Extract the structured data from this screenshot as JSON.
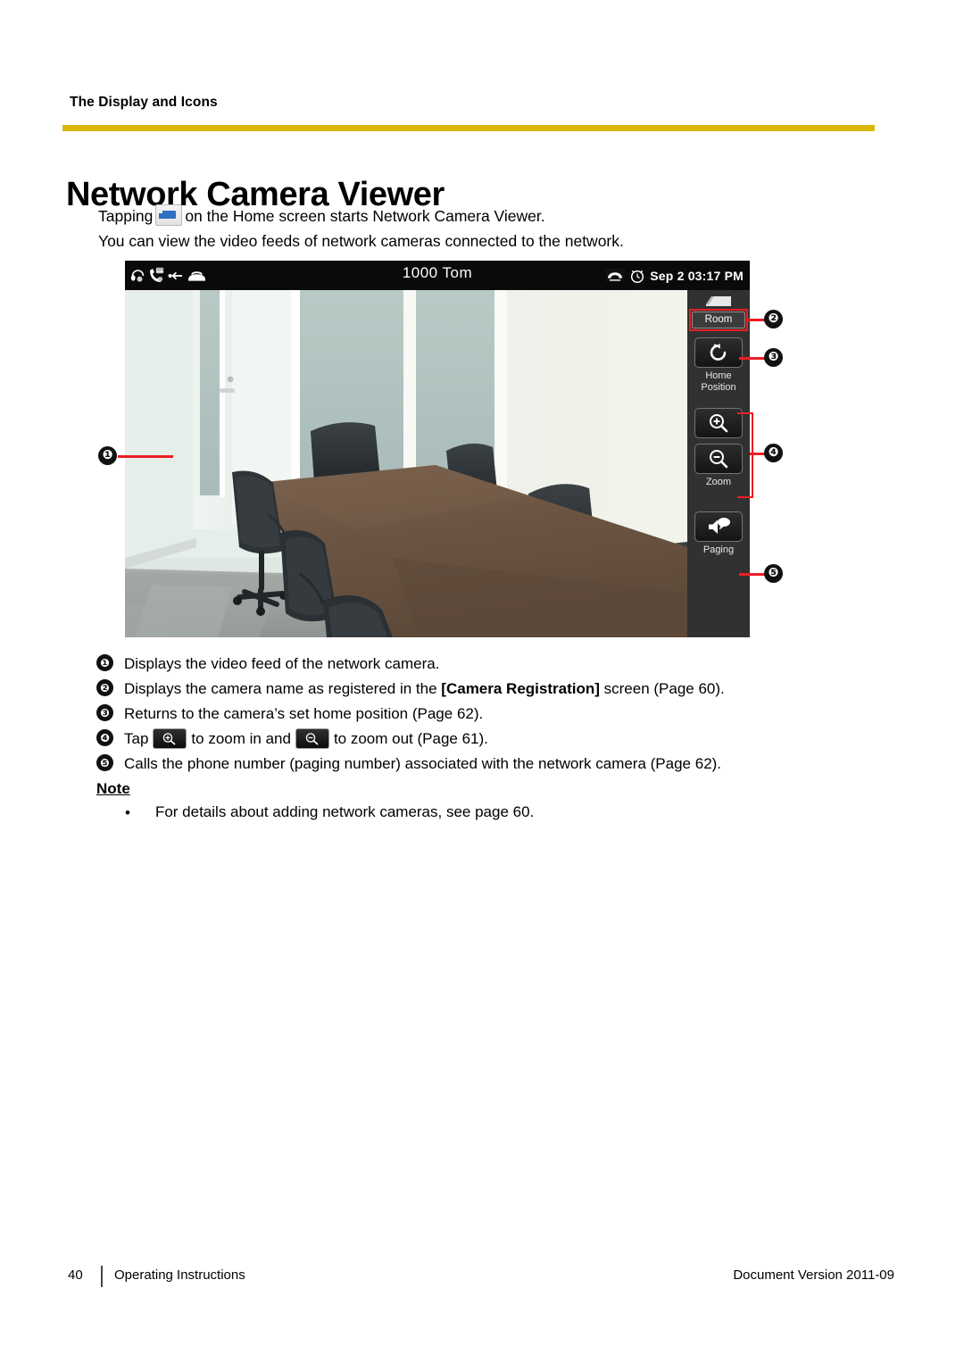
{
  "running_head": "The Display and Icons",
  "page_title": "Network Camera Viewer",
  "intro": {
    "line1_before": "Tapping",
    "home_icon": "network-camera-app-icon",
    "line1_after": "on the Home screen starts Network Camera Viewer.",
    "line2": "You can view the video feeds of network cameras connected to the network."
  },
  "device": {
    "statusbar": {
      "left_icons": [
        "headset-icon",
        "handset-message-icon",
        "call-forward-icon",
        "onhook-phone-icon"
      ],
      "title": "1000  Tom",
      "right_icons": [
        "missed-call-icon",
        "alarm-clock-icon"
      ],
      "datetime": "Sep 2 03:17 PM"
    },
    "video_feed_alt": "conference-room-video-feed",
    "rail": {
      "camera_glyph": "camera-icon",
      "camera_name": "Room",
      "home_icon": "home-position-icon",
      "home_label_line1": "Home",
      "home_label_line2": "Position",
      "zoom_in_icon": "zoom-in-icon",
      "zoom_out_icon": "zoom-out-icon",
      "zoom_label": "Zoom",
      "paging_icon": "paging-speaker-icon",
      "paging_label": "Paging"
    }
  },
  "callouts": {
    "one": "❶",
    "two": "❷",
    "three": "❸",
    "four": "❹",
    "five": "❺"
  },
  "legend": [
    {
      "num": "❶",
      "parts": [
        {
          "t": "Displays the video feed of the network camera.",
          "bold": false
        }
      ]
    },
    {
      "num": "❷",
      "parts": [
        {
          "t": "Displays the camera name as registered in the ",
          "bold": false
        },
        {
          "t": "[Camera Registration]",
          "bold": true
        },
        {
          "t": " screen (Page 60).",
          "bold": false
        }
      ]
    },
    {
      "num": "❸",
      "parts": [
        {
          "t": "Returns to the camera’s set home position (Page 62).",
          "bold": false
        }
      ]
    },
    {
      "num": "❹",
      "parts": [
        {
          "t": "Tap",
          "bold": false
        },
        {
          "icon": "zoom-in-icon"
        },
        {
          "t": "to zoom in and",
          "bold": false
        },
        {
          "icon": "zoom-out-icon"
        },
        {
          "t": "to zoom out (Page 61).",
          "bold": false
        }
      ]
    },
    {
      "num": "❺",
      "parts": [
        {
          "t": "Calls the phone number (paging number) associated with the network camera (Page 62).",
          "bold": false
        }
      ]
    }
  ],
  "note": {
    "title": "Note",
    "bullet": "•",
    "text": "For details about adding network cameras, see page 60."
  },
  "footer": {
    "page_number": "40",
    "label": "Operating Instructions",
    "version": "Document Version  2011-09"
  },
  "colors": {
    "rule": "#dcb70b",
    "callout_red": "#ee1c24",
    "rail_bg": "#313131",
    "statusbar_bg": "#0a0a0a"
  }
}
